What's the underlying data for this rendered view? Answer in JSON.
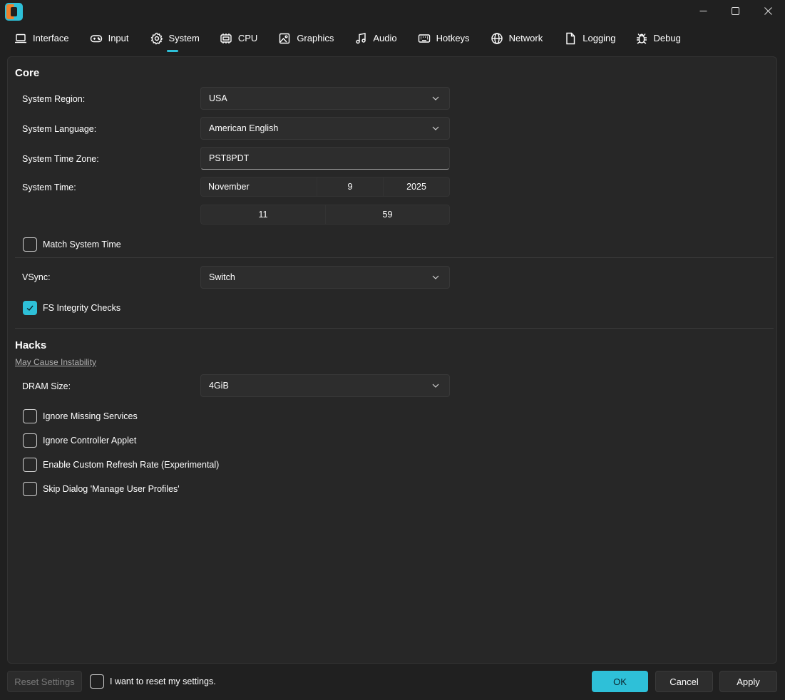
{
  "window": {
    "tabs": [
      {
        "label": "Interface",
        "icon": "laptop-icon"
      },
      {
        "label": "Input",
        "icon": "gamepad-icon"
      },
      {
        "label": "System",
        "icon": "gear-icon"
      },
      {
        "label": "CPU",
        "icon": "cpu-icon"
      },
      {
        "label": "Graphics",
        "icon": "image-icon"
      },
      {
        "label": "Audio",
        "icon": "music-icon"
      },
      {
        "label": "Hotkeys",
        "icon": "keyboard-icon"
      },
      {
        "label": "Network",
        "icon": "globe-icon"
      },
      {
        "label": "Logging",
        "icon": "document-icon"
      },
      {
        "label": "Debug",
        "icon": "bug-icon"
      }
    ],
    "active_tab": "System"
  },
  "core": {
    "title": "Core",
    "region_label": "System Region:",
    "region_value": "USA",
    "language_label": "System Language:",
    "language_value": "American English",
    "timezone_label": "System Time Zone:",
    "timezone_value": "PST8PDT",
    "time_label": "System Time:",
    "date_month": "November",
    "date_day": "9",
    "date_year": "2025",
    "time_hour": "11",
    "time_minute": "59",
    "match_time_label": "Match System Time",
    "match_time_checked": false,
    "vsync_label": "VSync:",
    "vsync_value": "Switch",
    "fs_checks_label": "FS Integrity Checks",
    "fs_checks_checked": true
  },
  "hacks": {
    "title": "Hacks",
    "warning_link": "May Cause Instability",
    "dram_label": "DRAM Size:",
    "dram_value": "4GiB",
    "ignore_services_label": "Ignore Missing Services",
    "ignore_applet_label": "Ignore Controller Applet",
    "custom_refresh_label": "Enable Custom Refresh Rate (Experimental)",
    "skip_dialog_label": "Skip Dialog 'Manage User Profiles'"
  },
  "footer": {
    "reset_label": "Reset Settings",
    "confirm_reset_label": "I want to reset my settings.",
    "ok_label": "OK",
    "cancel_label": "Cancel",
    "apply_label": "Apply"
  },
  "colors": {
    "accent": "#2ec0d8",
    "background": "#202020",
    "panel": "#272727"
  }
}
